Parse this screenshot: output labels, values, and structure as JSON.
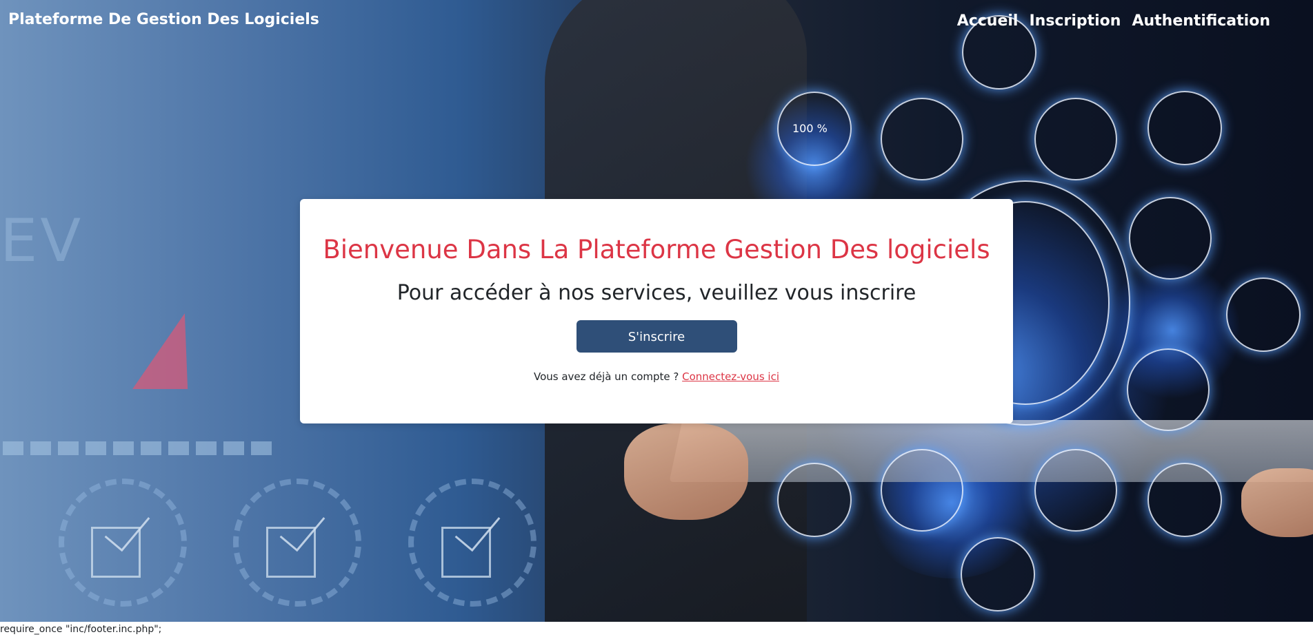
{
  "navbar": {
    "brand": "Plateforme De Gestion Des Logiciels",
    "links": [
      "Accueil",
      "Inscription",
      "Authentification"
    ]
  },
  "card": {
    "title": "Bienvenue Dans La Plateforme Gestion Des logiciels",
    "subtitle": "Pour accéder à nos services, veuillez vous inscrire",
    "button_label": "S'inscrire",
    "login_prompt": "Vous avez déjà un compte ?",
    "login_link": "Connectez-vous ici"
  },
  "hero": {
    "gauge_text": "100 %",
    "ev_text": "EV"
  },
  "footer": {
    "code_text": "require_once \"inc/footer.inc.php\";"
  },
  "colors": {
    "title_red": "#dc3545",
    "button_blue": "#2f4f78",
    "text_dark": "#212529"
  }
}
